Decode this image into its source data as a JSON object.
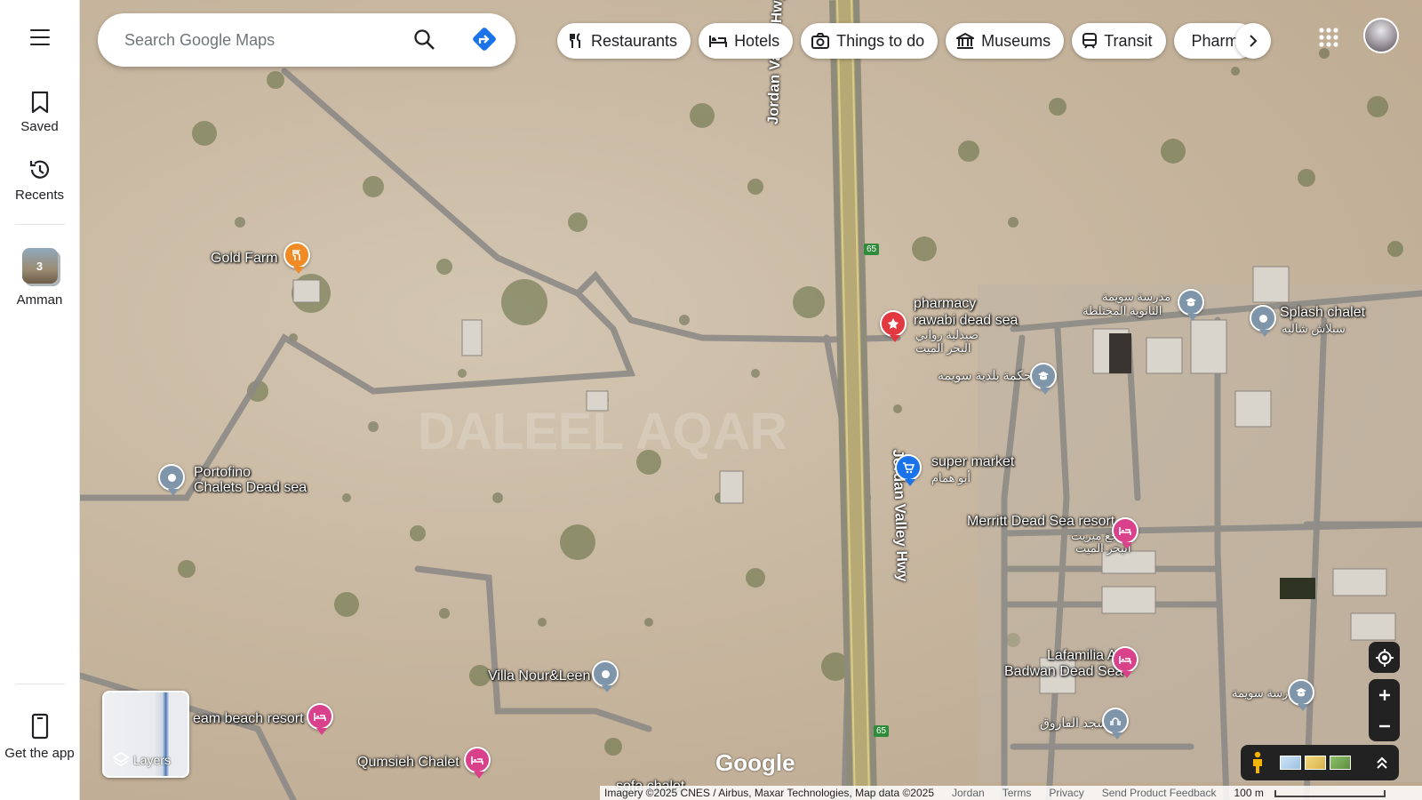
{
  "sidebar": {
    "menu_icon": "hamburger-menu-icon",
    "saved_label": "Saved",
    "recents_label": "Recents",
    "amman_label": "Amman",
    "amman_count": "3",
    "get_app_label": "Get the app"
  },
  "search": {
    "placeholder": "Search Google Maps"
  },
  "chips": [
    {
      "label": "Restaurants",
      "icon": "fork-knife-icon"
    },
    {
      "label": "Hotels",
      "icon": "bed-icon"
    },
    {
      "label": "Things to do",
      "icon": "camera-icon"
    },
    {
      "label": "Museums",
      "icon": "museum-icon"
    },
    {
      "label": "Transit",
      "icon": "train-icon"
    },
    {
      "label": "Pharmacies",
      "icon": "pharmacy-icon"
    }
  ],
  "places": {
    "gold_farm": "Gold Farm",
    "pharmacy_en_1": "pharmacy",
    "pharmacy_en_2": "rawabi dead sea",
    "pharmacy_ar_1": "صيدلية روابي",
    "pharmacy_ar_2": "البحر الميت",
    "school_top_ar_1": "مدرسة سويمة",
    "school_top_ar_2": "الثانوية المختلطة",
    "splash_chalet": "Splash chalet",
    "splash_ar": "سبلاش شاليه",
    "court_ar": "محكمة بلدية سويمه",
    "super_market": "super market",
    "super_market_ar": "أبو همام",
    "portofino_1": "Portofino",
    "portofino_2": "Chalets Dead sea",
    "merritt": "Merritt Dead Sea resort",
    "merritt_ar_1": "منتجع ميريت",
    "merritt_ar_2": "البحر الميت",
    "lafamilia_1": "Lafamilia Al",
    "lafamilia_2": "Badwan Dead Sea",
    "school_right_ar": "مدرسة سويمة",
    "mosque_ar": "مسجد الفاروق",
    "villa": "Villa Nour&Leen",
    "beach_resort": "eam beach resort",
    "qumsieh": "Qumsieh Chalet",
    "sofa_chalet": "sofa chalet"
  },
  "roads": {
    "highway_name": "Jordan Valley Hwy",
    "shield": "65"
  },
  "watermark": "DALEEL AQAR",
  "layers_label": "Layers",
  "google_logo": "Google",
  "footer": {
    "attribution": "Imagery ©2025 CNES / Airbus, Maxar Technologies, Map data ©2025",
    "region": "Jordan",
    "terms": "Terms",
    "privacy": "Privacy",
    "feedback": "Send Product Feedback",
    "scale": "100 m"
  },
  "colors": {
    "pin_gray": "#7f95a9",
    "pin_pink": "#d9418b",
    "pin_orange": "#f08a24",
    "pin_red": "#e2383f",
    "pin_blue": "#1a73e8",
    "directions_accent": "#1a73e8"
  }
}
